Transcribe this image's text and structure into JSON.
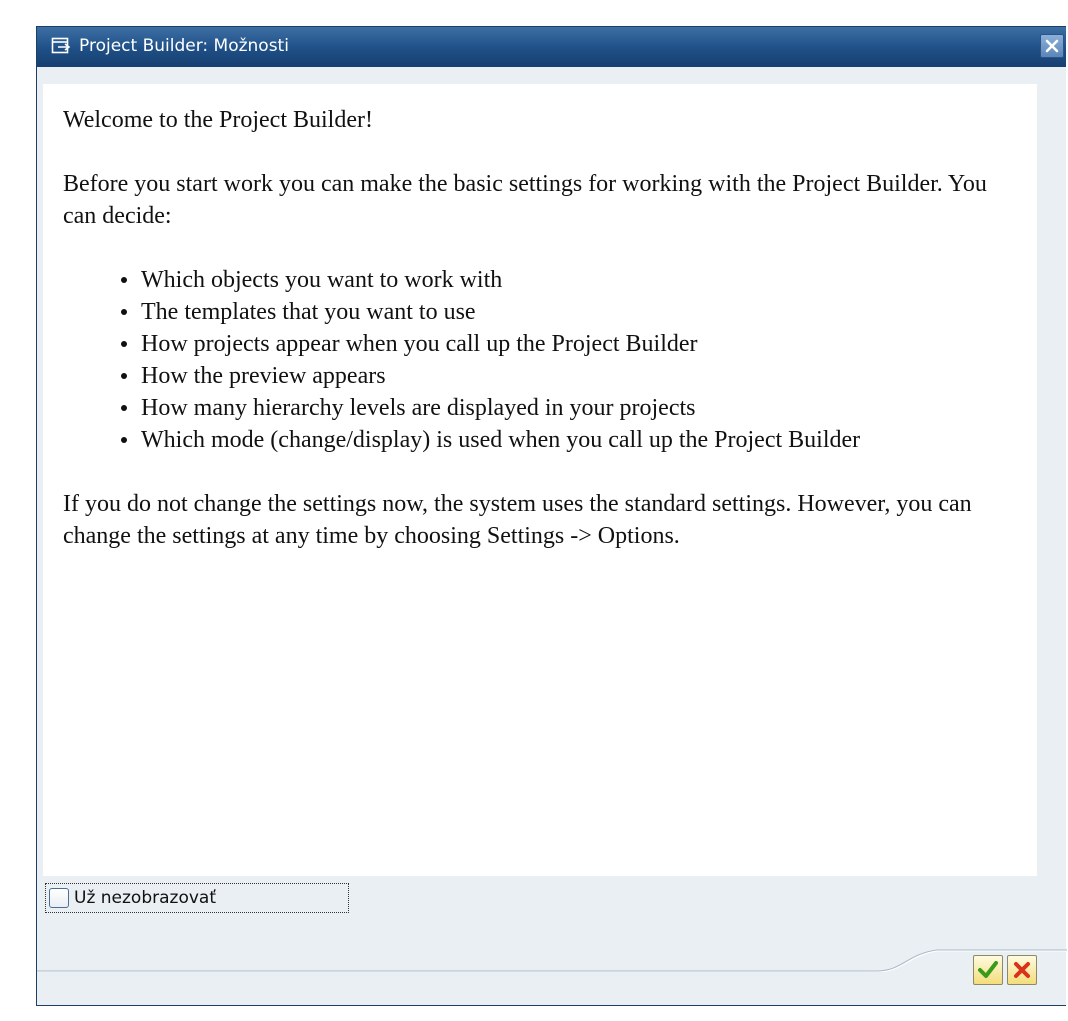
{
  "window": {
    "title": "Project Builder: Možnosti",
    "title_icon": "dialog-icon",
    "close_icon": "close-icon"
  },
  "content": {
    "intro": "Welcome to the Project Builder!",
    "before": "Before you start work you can make the basic settings for working with the Project Builder. You can decide:",
    "bullets": [
      "Which objects you want to work with",
      "The templates that you want to use",
      "How projects appear when you call up the Project Builder",
      "How the preview appears",
      "How many hierarchy levels are displayed in your projects",
      "Which mode (change/display) is used when you call up the Project Builder"
    ],
    "closing": "If you do not change the settings now, the system uses the standard settings. However, you can change the settings at any time by choosing Settings -> Options."
  },
  "checkbox": {
    "label": "Už nezobrazovať",
    "checked": false
  },
  "buttons": {
    "ok_icon": "checkmark-icon",
    "cancel_icon": "cancel-x-icon"
  },
  "colors": {
    "titlebar": "#1e4f86",
    "window_bg": "#eaeff4",
    "ok_green": "#3a9a1a",
    "cancel_red": "#d8321a"
  }
}
